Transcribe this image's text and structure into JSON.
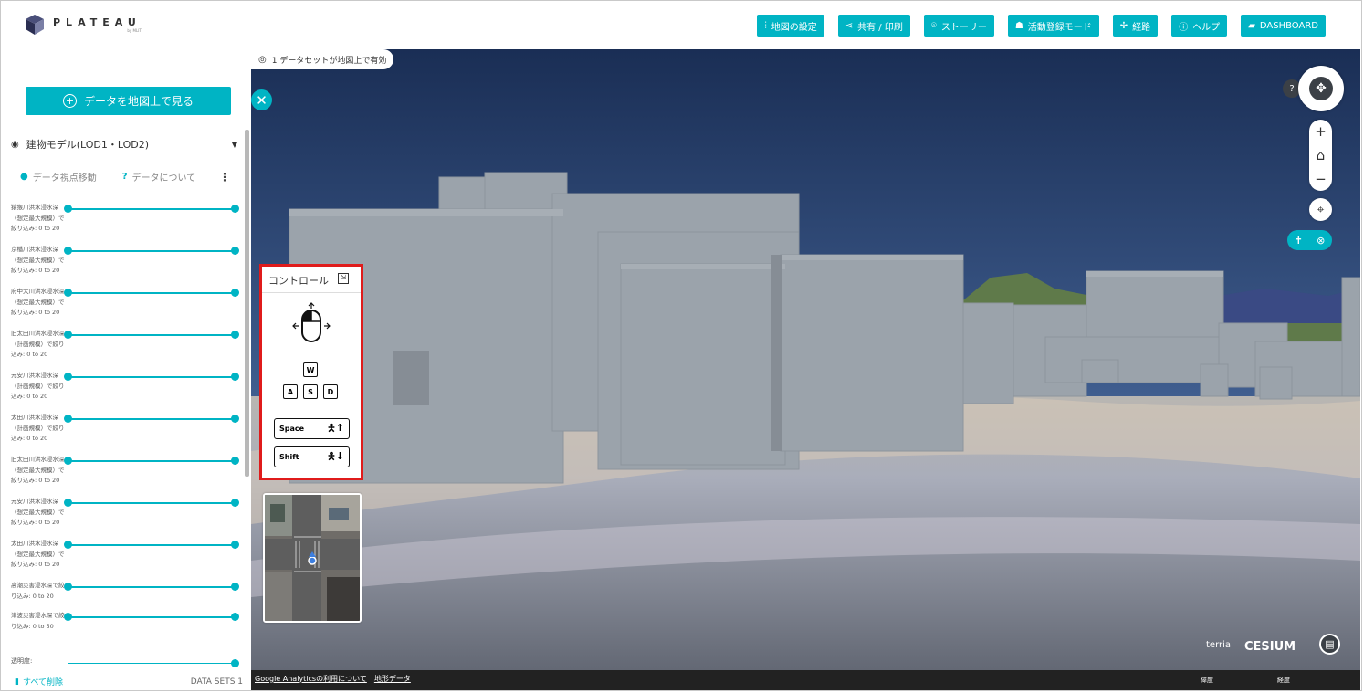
{
  "brand": {
    "name": "PLATEAU",
    "sub": "by MLIT"
  },
  "nav": [
    {
      "icon": "settings-sliders-icon",
      "label": "地図の設定"
    },
    {
      "icon": "share-icon",
      "label": "共有 / 印刷"
    },
    {
      "icon": "story-icon",
      "label": "ストーリー"
    },
    {
      "icon": "people-icon",
      "label": "活動登録モード"
    },
    {
      "icon": "route-icon",
      "label": "経路"
    },
    {
      "icon": "help-circle-icon",
      "label": "ヘルプ"
    },
    {
      "icon": "book-icon",
      "label": "DASHBOARD"
    }
  ],
  "sidebar": {
    "add_data_label": "データを地図上で見る",
    "layer_title": "建物モデル(LOD1・LOD2)",
    "zoom_to_label": "データ視点移動",
    "about_label": "データについて",
    "filters": [
      "猿猴川洪水浸水深（想定最大規模）で絞り込み: 0 to 20",
      "京橋川洪水浸水深（想定最大規模）で絞り込み: 0 to 20",
      "府中大川洪水浸水深（想定最大規模）で絞り込み: 0 to 20",
      "旧太田川洪水浸水深（計画規模）で絞り込み: 0 to 20",
      "元安川洪水浸水深（計画規模）で絞り込み: 0 to 20",
      "太田川洪水浸水深（計画規模）で絞り込み: 0 to 20",
      "旧太田川洪水浸水深（想定最大規模）で絞り込み: 0 to 20",
      "元安川洪水浸水深（想定最大規模）で絞り込み: 0 to 20",
      "太田川洪水浸水深（想定最大規模）で絞り込み: 0 to 20",
      "高潮災害浸水深で絞り込み: 0 to 20",
      "津波災害浸水深で絞り込み: 0 to 50"
    ],
    "opacity_label": "透明度:",
    "remove_all_label": "すべて削除",
    "datasets_label": "DATA SETS 1"
  },
  "map": {
    "dataset_chip": "1 データセットが地図上で有効",
    "controls_title": "コントロール",
    "keys": {
      "w": "W",
      "a": "A",
      "s": "S",
      "d": "D",
      "space": "Space",
      "shift": "Shift"
    },
    "help_mark": "?",
    "bottom_links": [
      "Google Analyticsの利用について",
      "地形データ"
    ],
    "lat_label": "緯度",
    "lon_label": "経度",
    "terria_label": "terria",
    "cesium_label": "CESIUM"
  },
  "colors": {
    "accent": "#00b4c4",
    "highlight_border": "#e01b1b",
    "dark_control": "#3b4046"
  }
}
